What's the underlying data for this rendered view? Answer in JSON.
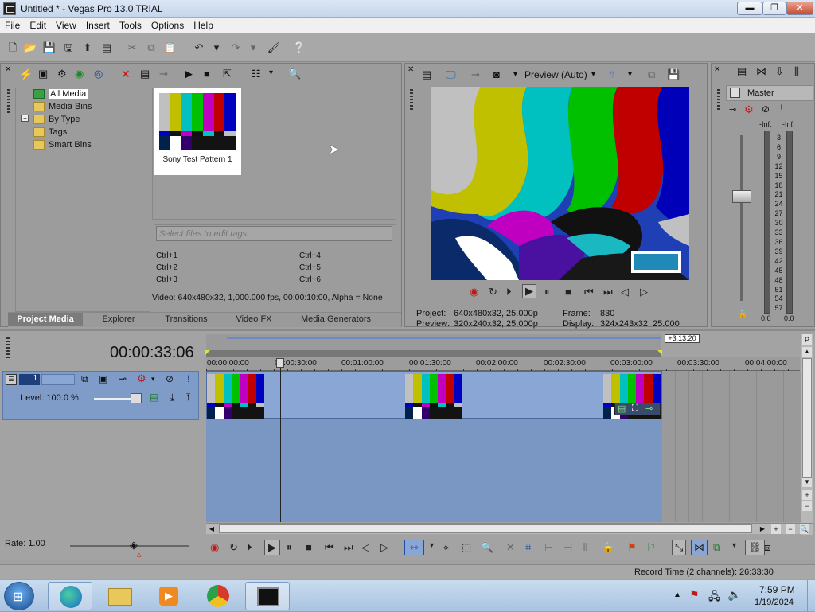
{
  "window": {
    "title": "Untitled * - Vegas Pro 13.0 TRIAL",
    "min": "▬",
    "max": "❐",
    "close": "✕"
  },
  "menu": [
    "File",
    "Edit",
    "View",
    "Insert",
    "Tools",
    "Options",
    "Help"
  ],
  "media_tree": {
    "items": [
      "All Media",
      "Media Bins",
      "By Type",
      "Tags",
      "Smart Bins"
    ],
    "expand": "+"
  },
  "media_item": {
    "label": "Sony Test Pattern 1"
  },
  "tags": {
    "placeholder": "Select files to edit tags",
    "shortcuts": [
      "Ctrl+1",
      "Ctrl+4",
      "Ctrl+2",
      "Ctrl+5",
      "Ctrl+3",
      "Ctrl+6"
    ]
  },
  "media_info": "Video: 640x480x32, 1,000.000 fps, 00:00:10:00, Alpha = None",
  "tabs": [
    "Project Media",
    "Explorer",
    "Transitions",
    "Video FX",
    "Media Generators"
  ],
  "preview": {
    "mode": "Preview (Auto)",
    "project_label": "Project:",
    "project_value": "640x480x32, 25.000p",
    "preview_label": "Preview:",
    "preview_value": "320x240x32, 25.000p",
    "frame_label": "Frame:",
    "frame_value": "830",
    "display_label": "Display:",
    "display_value": "324x243x32, 25.000"
  },
  "master": {
    "label": "Master",
    "inf_left": "-Inf.",
    "inf_right": "-Inf.",
    "scale": [
      "3",
      "6",
      "9",
      "12",
      "15",
      "18",
      "21",
      "24",
      "27",
      "30",
      "33",
      "36",
      "39",
      "42",
      "45",
      "48",
      "51",
      "54",
      "57"
    ],
    "bottom_left": "0.0",
    "bottom_right": "0.0"
  },
  "timeline": {
    "timecode": "00:00:33:06",
    "duration_badge": "+3:13:20",
    "ruler": [
      "00:00:00:00",
      "00:00:30:00",
      "00:01:00:00",
      "00:01:30:00",
      "00:02:00:00",
      "00:02:30:00",
      "00:03:00:00",
      "00:03:30:00",
      "00:04:00:00"
    ],
    "track_number": "1",
    "level": "Level: 100.0 %",
    "rate": "Rate: 1.00"
  },
  "status": {
    "record_time": "Record Time (2 channels): 26:33:30"
  },
  "taskbar": {
    "time": "7:59 PM",
    "date": "1/19/2024"
  },
  "colors": {
    "panel": "#9c9c9c",
    "track": "#7a97c4",
    "accent": "#1f4fa0"
  }
}
